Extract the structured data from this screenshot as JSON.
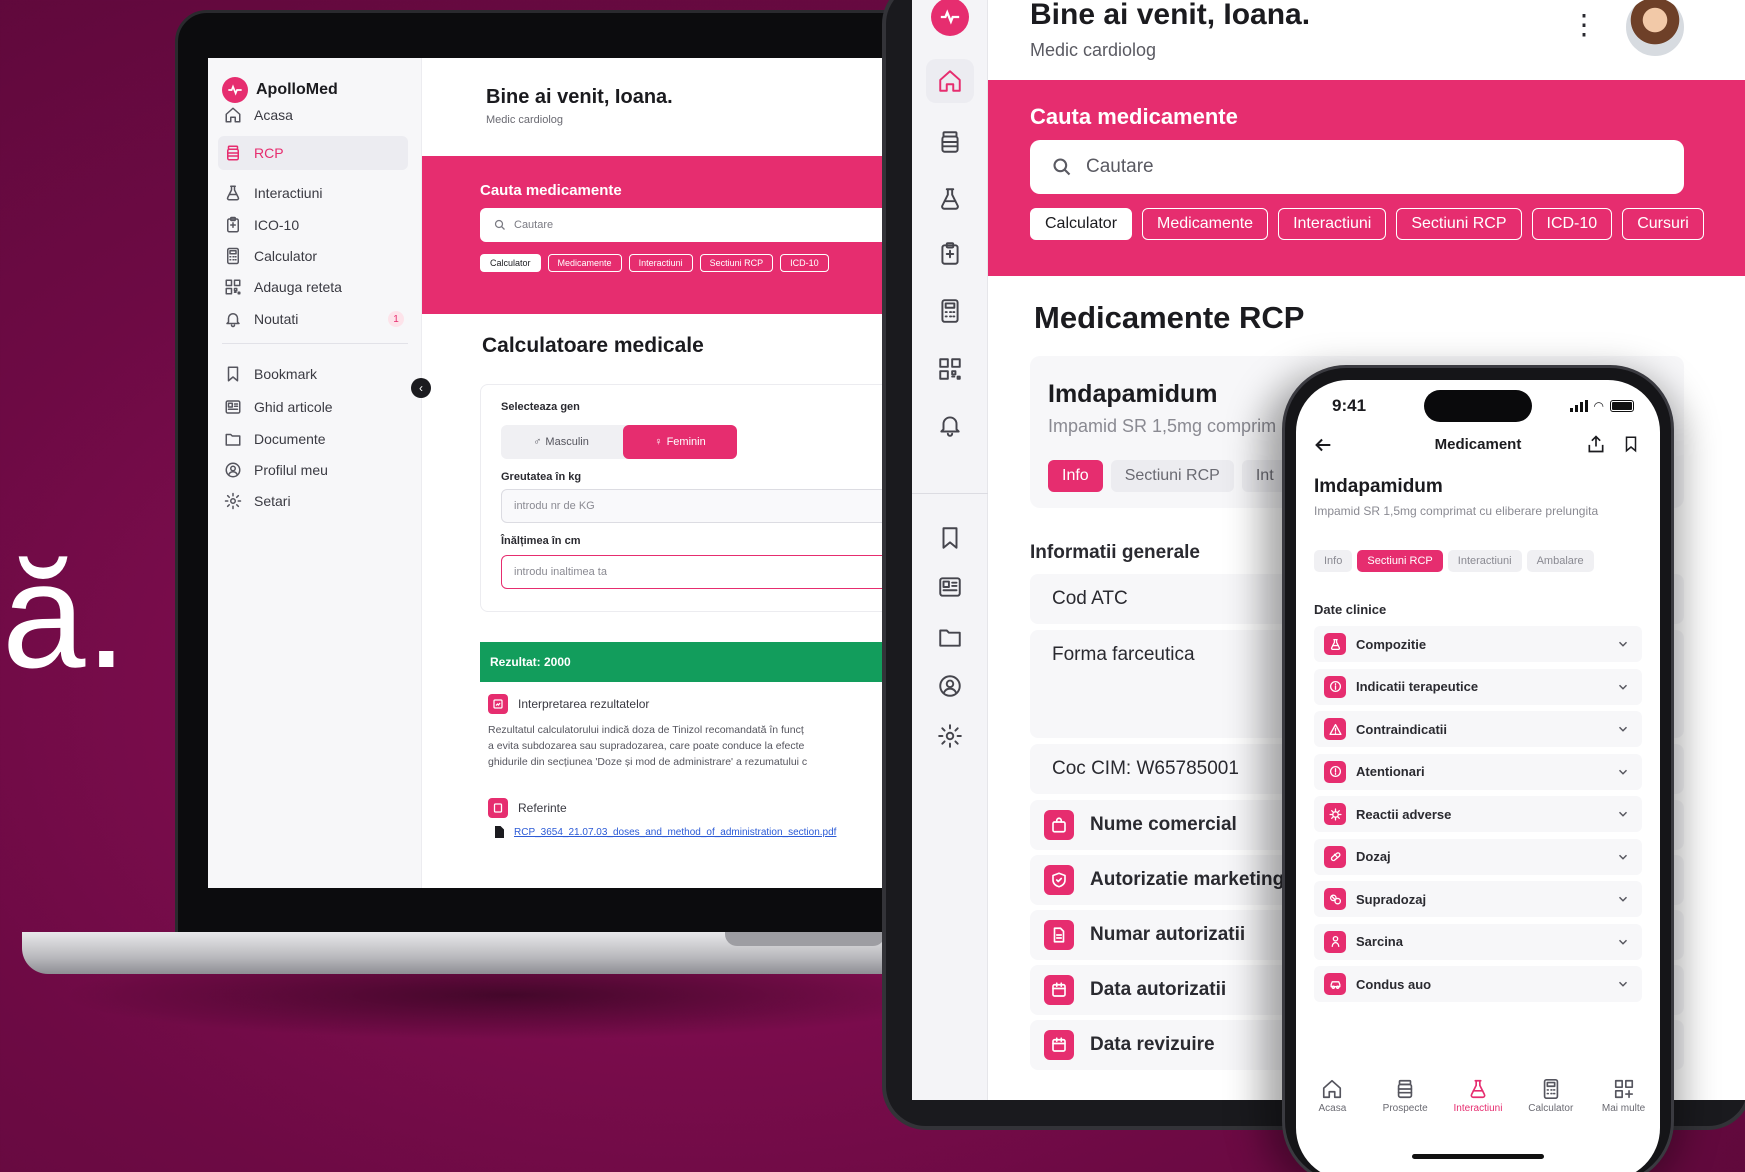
{
  "backdrop": {
    "letter": "ă."
  },
  "laptop": {
    "brand": "ApolloMed",
    "nav": [
      {
        "label": "Acasa",
        "icon": "home-icon"
      },
      {
        "label": "RCP",
        "icon": "pill-bottle-icon",
        "active": true
      },
      {
        "label": "Interactiuni",
        "icon": "flask-icon"
      },
      {
        "label": "ICO-10",
        "icon": "clipboard-icon"
      },
      {
        "label": "Calculator",
        "icon": "calculator-icon"
      },
      {
        "label": "Adauga reteta",
        "icon": "qr-code-icon"
      },
      {
        "label": "Noutati",
        "icon": "bell-icon",
        "badge": "1"
      },
      {
        "label": "Bookmark",
        "icon": "bookmark-icon"
      },
      {
        "label": "Ghid articole",
        "icon": "newspaper-icon"
      },
      {
        "label": "Documente",
        "icon": "folder-icon"
      },
      {
        "label": "Profilul meu",
        "icon": "user-circle-icon"
      },
      {
        "label": "Setari",
        "icon": "gear-icon"
      }
    ],
    "greeting": "Bine ai venit, Ioana.",
    "role": "Medic cardiolog",
    "search_title": "Cauta medicamente",
    "search_placeholder": "Cautare",
    "chips": [
      "Calculator",
      "Medicamente",
      "Interactiuni",
      "Sectiuni RCP",
      "ICD-10"
    ],
    "section_title": "Calculatoare medicale",
    "gender_label": "Selecteaza gen",
    "gender_male": "Masculin",
    "gender_female": "Feminin",
    "weight_label": "Greutatea în kg",
    "weight_placeholder": "introdu nr de KG",
    "height_label": "Înălțimea în cm",
    "height_placeholder": "introdu inaltimea ta",
    "result": "Rezultat: 2000",
    "interpretation_title": "Interpretarea rezultatelor",
    "interpretation_lines": [
      "Rezultatul calculatorului indică doza de Tinizol recomandată în funcț",
      "a evita subdozarea sau supradozarea, care poate conduce la efecte",
      "ghidurile din secțiunea 'Doze și mod de administrare' a rezumatului c"
    ],
    "references_title": "Referinte",
    "reference_link": "RCP_3654_21.07.03_doses_and_method_of_administration_section.pdf"
  },
  "tablet": {
    "rail_icons": [
      "home-icon",
      "pill-bottle-icon",
      "flask-icon",
      "clipboard-icon",
      "calculator-icon",
      "qr-code-icon",
      "bell-icon",
      "bookmark-icon",
      "newspaper-icon",
      "folder-icon",
      "user-circle-icon",
      "gear-icon"
    ],
    "greeting": "Bine ai venit, Ioana.",
    "role": "Medic cardiolog",
    "search_title": "Cauta medicamente",
    "search_placeholder": "Cautare",
    "chips": [
      "Calculator",
      "Medicamente",
      "Interactiuni",
      "Sectiuni RCP",
      "ICD-10",
      "Cursuri"
    ],
    "section_title": "Medicamente RCP",
    "drug_name": "Imdapamidum",
    "drug_sub": "Impamid SR 1,5mg comprim",
    "drug_tabs": [
      "Info",
      "Sectiuni RCP",
      "Int"
    ],
    "info_title": "Informatii generale",
    "plain_rows": [
      "Cod ATC",
      "Forma farceutica",
      "Coc CIM: W65785001"
    ],
    "icon_rows": [
      {
        "label": "Nume comercial",
        "icon": "bag-icon"
      },
      {
        "label": "Autorizatie marketing",
        "icon": "shield-check-icon"
      },
      {
        "label": "Numar autorizatii",
        "icon": "document-icon"
      },
      {
        "label": "Data autorizatii",
        "icon": "calendar-icon"
      },
      {
        "label": "Data revizuire",
        "icon": "calendar-icon"
      }
    ]
  },
  "phone": {
    "time": "9:41",
    "title": "Medicament",
    "drug_name": "Imdapamidum",
    "drug_sub": "Impamid SR 1,5mg comprimat cu eliberare prelungita",
    "tabs": [
      "Info",
      "Sectiuni RCP",
      "Interactiuni",
      "Ambalare"
    ],
    "active_tab": "Sectiuni RCP",
    "section_title": "Date clinice",
    "rows": [
      {
        "label": "Compozitie",
        "icon": "flask-icon"
      },
      {
        "label": "Indicatii terapeutice",
        "icon": "info-icon"
      },
      {
        "label": "Contraindicatii",
        "icon": "warning-icon"
      },
      {
        "label": "Atentionari",
        "icon": "alert-icon"
      },
      {
        "label": "Reactii adverse",
        "icon": "virus-icon"
      },
      {
        "label": "Dozaj",
        "icon": "pill-icon"
      },
      {
        "label": "Supradozaj",
        "icon": "pills-icon"
      },
      {
        "label": "Sarcina",
        "icon": "baby-icon"
      },
      {
        "label": "Condus auo",
        "icon": "car-icon"
      }
    ],
    "bottom_nav": [
      {
        "label": "Acasa",
        "icon": "home-icon"
      },
      {
        "label": "Prospecte",
        "icon": "pill-bottle-icon"
      },
      {
        "label": "Interactiuni",
        "icon": "flask-icon",
        "active": true
      },
      {
        "label": "Calculator",
        "icon": "calculator-icon"
      },
      {
        "label": "Mai multe",
        "icon": "grid-plus-icon"
      }
    ]
  },
  "colors": {
    "brand": "#e62d6f",
    "background": "#7a0c4c",
    "success": "#129d5c"
  }
}
